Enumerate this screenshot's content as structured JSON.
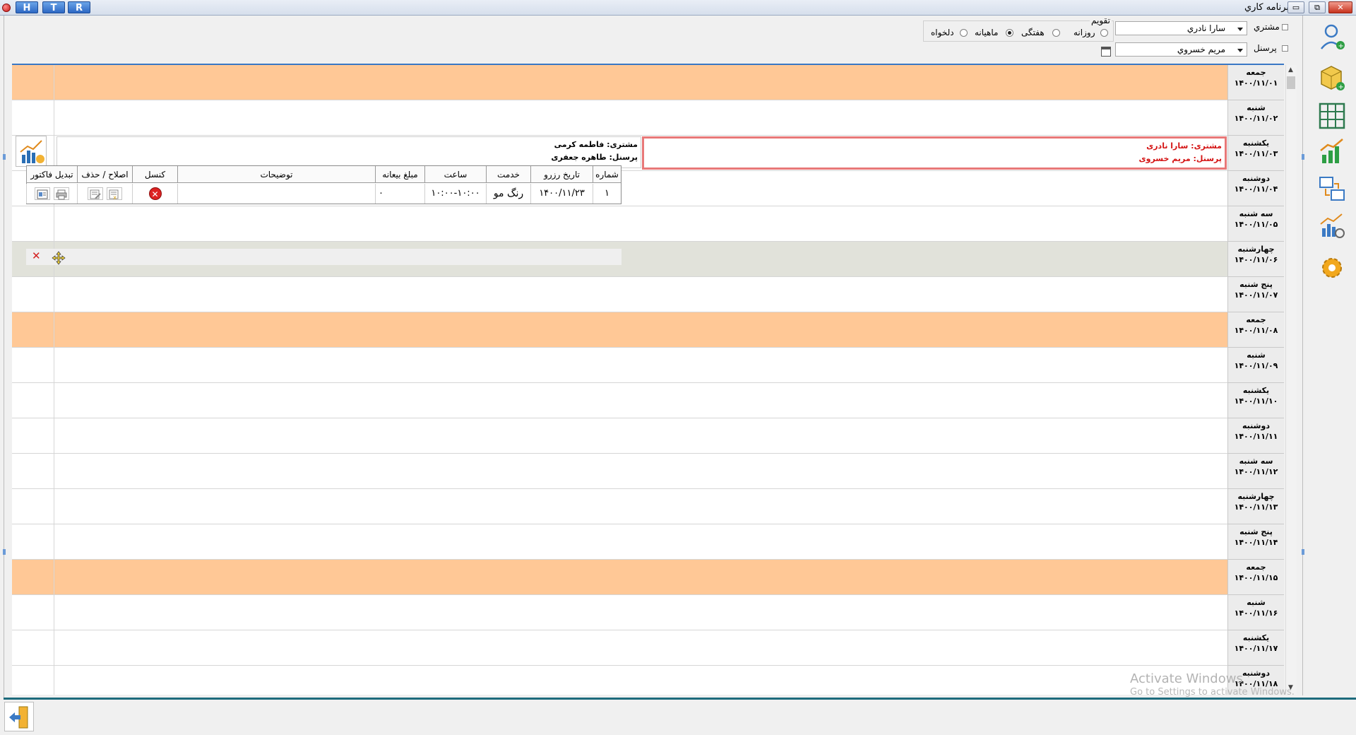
{
  "window": {
    "title": "برنامه كاري",
    "quick_buttons": [
      "H",
      "T",
      "R"
    ],
    "controls": {
      "minimize": "▭",
      "restore": "⧉",
      "close": "✕"
    }
  },
  "filters": {
    "customer_label": "مشتري",
    "customer_value": "سارا نادري",
    "staff_label": "پرسنل",
    "staff_value": "مريم خسروي",
    "calendar_title": "تقویم",
    "view_options": [
      {
        "label": "روزانه",
        "checked": false
      },
      {
        "label": "هفتگی",
        "checked": false
      },
      {
        "label": "ماهیانه",
        "checked": true
      },
      {
        "label": "دلخواه",
        "checked": false
      }
    ]
  },
  "days": [
    {
      "name": "جمعه",
      "date": "۱۴۰۰/۱۱/۰۱",
      "type": "fri"
    },
    {
      "name": "شنبه",
      "date": "۱۴۰۰/۱۱/۰۲",
      "type": ""
    },
    {
      "name": "یکشنبه",
      "date": "۱۴۰۰/۱۱/۰۳",
      "type": ""
    },
    {
      "name": "دوشنبه",
      "date": "۱۴۰۰/۱۱/۰۴",
      "type": ""
    },
    {
      "name": "سه شنبه",
      "date": "۱۴۰۰/۱۱/۰۵",
      "type": ""
    },
    {
      "name": "چهارشنبه",
      "date": "۱۴۰۰/۱۱/۰۶",
      "type": "sel"
    },
    {
      "name": "پنج شنبه",
      "date": "۱۴۰۰/۱۱/۰۷",
      "type": ""
    },
    {
      "name": "جمعه",
      "date": "۱۴۰۰/۱۱/۰۸",
      "type": "fri"
    },
    {
      "name": "شنبه",
      "date": "۱۴۰۰/۱۱/۰۹",
      "type": ""
    },
    {
      "name": "یکشنبه",
      "date": "۱۴۰۰/۱۱/۱۰",
      "type": ""
    },
    {
      "name": "دوشنبه",
      "date": "۱۴۰۰/۱۱/۱۱",
      "type": ""
    },
    {
      "name": "سه شنبه",
      "date": "۱۴۰۰/۱۱/۱۲",
      "type": ""
    },
    {
      "name": "چهارشنبه",
      "date": "۱۴۰۰/۱۱/۱۳",
      "type": ""
    },
    {
      "name": "پنج شنبه",
      "date": "۱۴۰۰/۱۱/۱۴",
      "type": ""
    },
    {
      "name": "جمعه",
      "date": "۱۴۰۰/۱۱/۱۵",
      "type": "fri"
    },
    {
      "name": "شنبه",
      "date": "۱۴۰۰/۱۱/۱۶",
      "type": ""
    },
    {
      "name": "یکشنبه",
      "date": "۱۴۰۰/۱۱/۱۷",
      "type": ""
    },
    {
      "name": "دوشنبه",
      "date": "۱۴۰۰/۱۱/۱۸",
      "type": ""
    }
  ],
  "appointments": {
    "highlight": {
      "customer": "مشتری: سارا نادری",
      "staff": "پرسنل: مریم خسروی"
    },
    "popup": {
      "customer": "مشتری: فاطمه کرمی",
      "staff": "پرسنل: طاهره جعفری"
    }
  },
  "grid": {
    "headers": [
      "شماره",
      "تاریخ رزرو",
      "خدمت",
      "ساعت",
      "مبلغ بیعانه",
      "توضیحات",
      "کنسل",
      "اصلاح / حذف",
      "تبدیل فاکتور"
    ],
    "row": {
      "number": "۱",
      "date": "۱۴۰۰/۱۱/۲۳",
      "service": "رنگ مو",
      "time": "۱۰:۰۰-۱۰:۰۰",
      "deposit": "۰",
      "notes": ""
    }
  },
  "drag_bar": {
    "close": "✕"
  },
  "watermark": {
    "line1": "Activate Windows",
    "line2": "Go to Settings to activate Windows."
  },
  "colors": {
    "friday": "#ffc896",
    "selected": "#e1e2da",
    "highlight_border": "#e87878",
    "accent": "#1d6b7c"
  }
}
